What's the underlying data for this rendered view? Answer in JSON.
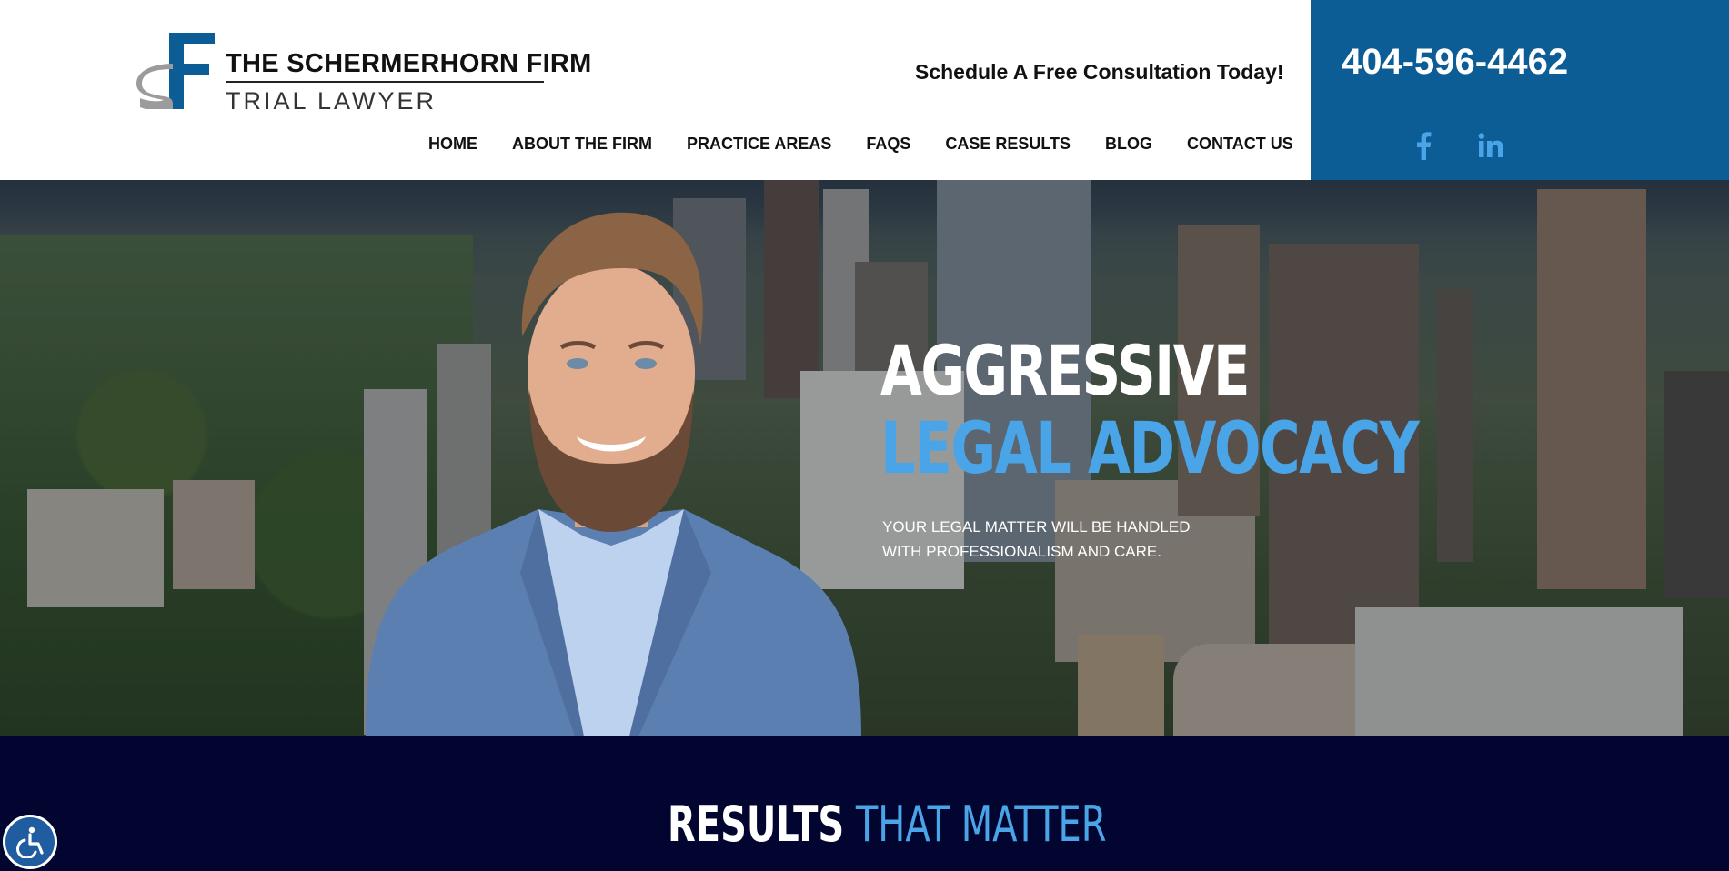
{
  "brand": {
    "name": "THE SCHERMERHORN FIRM",
    "tagline": "TRIAL LAWYER",
    "logo_mark": "SF",
    "colors": {
      "primary": "#0c5c96",
      "accent": "#4aa5e8",
      "navy": "#030531"
    }
  },
  "header": {
    "consult_text": "Schedule A Free Consultation Today!",
    "phone": "404-596-4462",
    "social": [
      {
        "label": "f",
        "icon": "facebook-icon"
      },
      {
        "label": "in",
        "icon": "linkedin-icon"
      }
    ]
  },
  "nav": {
    "items": [
      {
        "label": "HOME"
      },
      {
        "label": "ABOUT THE FIRM"
      },
      {
        "label": "PRACTICE AREAS"
      },
      {
        "label": "FAQS"
      },
      {
        "label": "CASE RESULTS"
      },
      {
        "label": "BLOG"
      },
      {
        "label": "CONTACT US"
      }
    ]
  },
  "hero": {
    "headline_line1": "AGGRESSIVE",
    "headline_line2": "LEGAL ADVOCACY",
    "subtext_line1": "YOUR LEGAL MATTER WILL BE HANDLED",
    "subtext_line2": "WITH PROFESSIONALISM AND CARE."
  },
  "results": {
    "title_white": "RESULTS",
    "title_blue": "THAT MATTER"
  },
  "accessibility": {
    "icon": "accessibility-icon"
  }
}
